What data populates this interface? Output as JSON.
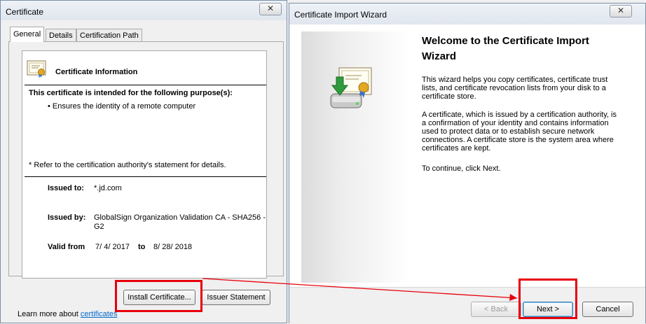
{
  "certificate_window": {
    "title": "Certificate",
    "close_glyph": "✕",
    "tabs": [
      "General",
      "Details",
      "Certification Path"
    ],
    "info_title": "Certificate Information",
    "purpose_heading": "This certificate is intended for the following purpose(s):",
    "purpose_item": "• Ensures the identity of a remote computer",
    "note": "* Refer to the certification authority's statement for details.",
    "issued_to_label": "Issued to:",
    "issued_to_value": "*.jd.com",
    "issued_by_label": "Issued by:",
    "issued_by_value_line1": "GlobalSign Organization Validation CA - SHA256 -",
    "issued_by_value_line2": "G2",
    "valid_from_label": "Valid from",
    "valid_from_value": "7/ 4/ 2017",
    "valid_to_label": "to",
    "valid_to_value": "8/ 28/ 2018",
    "install_button": "Install Certificate...",
    "issuer_button": "Issuer Statement",
    "learn_more_prefix": "Learn more about",
    "learn_more_link": "certificates"
  },
  "import_wizard": {
    "title": "Certificate Import Wizard",
    "close_glyph": "✕",
    "heading_line1": "Welcome to the Certificate Import",
    "heading_line2": "Wizard",
    "para1": [
      "This wizard helps you copy certificates, certificate trust",
      "lists, and certificate revocation lists from your disk to a",
      "certificate store."
    ],
    "para2": [
      "A certificate, which is issued by a certification authority, is",
      "a confirmation of your identity and contains information",
      "used to protect data or to establish secure network",
      "connections. A certificate store is the system area where",
      "certificates are kept."
    ],
    "para3": "To continue, click Next.",
    "back_button": "< Back",
    "next_button": "Next >",
    "cancel_button": "Cancel"
  },
  "colors": {
    "highlight": "#e8000b",
    "link": "#0066cc"
  },
  "icons": {
    "certificate": "certificate-icon",
    "import": "certificate-import-icon"
  }
}
